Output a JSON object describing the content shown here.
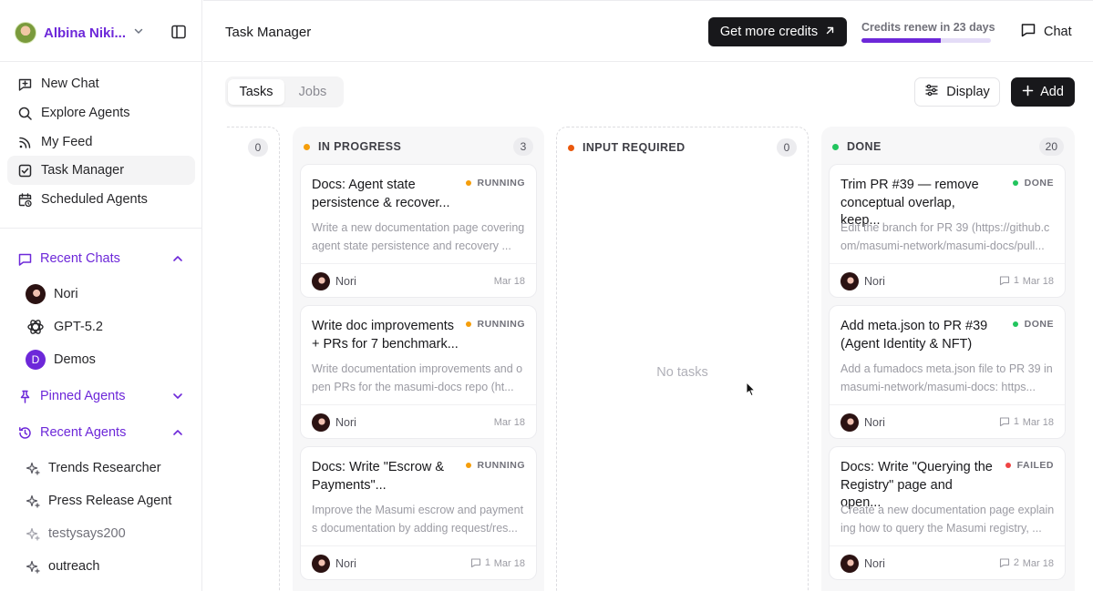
{
  "sidebar": {
    "user_name": "Albina Niki...",
    "nav": [
      {
        "label": "New Chat",
        "icon": "new-chat-icon"
      },
      {
        "label": "Explore Agents",
        "icon": "search-icon"
      },
      {
        "label": "My Feed",
        "icon": "rss-icon"
      },
      {
        "label": "Task Manager",
        "icon": "checkbox-icon",
        "active": true
      },
      {
        "label": "Scheduled Agents",
        "icon": "calendar-clock-icon"
      }
    ],
    "recent_chats": {
      "title": "Recent Chats",
      "items": [
        {
          "label": "Nori"
        },
        {
          "label": "GPT-5.2"
        },
        {
          "label": "Demos",
          "initial": "D"
        }
      ]
    },
    "pinned_agents": {
      "title": "Pinned Agents"
    },
    "recent_agents": {
      "title": "Recent Agents",
      "items": [
        {
          "label": "Trends Researcher"
        },
        {
          "label": "Press Release Agent"
        },
        {
          "label": "testysays200"
        },
        {
          "label": "outreach"
        }
      ]
    }
  },
  "header": {
    "title": "Task Manager",
    "credits_button": "Get more credits",
    "renew_text": "Credits renew in 23 days",
    "renew_progress": 0.61,
    "chat_button": "Chat"
  },
  "toolbar": {
    "tabs": [
      {
        "label": "Tasks",
        "active": true
      },
      {
        "label": "Jobs"
      }
    ],
    "display_button": "Display",
    "add_button": "Add"
  },
  "board": {
    "columns": [
      {
        "title": "",
        "count": "0"
      },
      {
        "title": "IN PROGRESS",
        "count": "3",
        "color": "#f59e0b",
        "cards": [
          {
            "title": "Docs: Agent state persistence & recover...",
            "status": "RUNNING",
            "desc": "Write a new documentation page covering agent state persistence and recovery ...",
            "assignee": "Nori",
            "comments": "",
            "date": "Mar 18"
          },
          {
            "title": "Write doc improvements + PRs for 7 benchmark...",
            "status": "RUNNING",
            "desc": "Write documentation improvements and open PRs for the masumi-docs repo (ht...",
            "assignee": "Nori",
            "comments": "",
            "date": "Mar 18"
          },
          {
            "title": "Docs: Write \"Escrow & Payments\"...",
            "status": "RUNNING",
            "desc": "Improve the Masumi escrow and payments documentation by adding request/res...",
            "assignee": "Nori",
            "comments": "1",
            "date": "Mar 18"
          }
        ]
      },
      {
        "title": "INPUT REQUIRED",
        "count": "0",
        "color": "#ea580c",
        "empty": "No tasks"
      },
      {
        "title": "DONE",
        "count": "20",
        "color": "#22c55e",
        "cards": [
          {
            "title": "Trim PR #39 — remove conceptual overlap, keep...",
            "status": "DONE",
            "desc": "Edit the branch for PR 39 (https://github.com/masumi-network/masumi-docs/pull...",
            "assignee": "Nori",
            "comments": "1",
            "date": "Mar 18"
          },
          {
            "title": "Add meta.json to PR #39 (Agent Identity & NFT)",
            "status": "DONE",
            "desc": "Add a fumadocs meta.json file to PR 39 in masumi-network/masumi-docs: https...",
            "assignee": "Nori",
            "comments": "1",
            "date": "Mar 18"
          },
          {
            "title": "Docs: Write \"Querying the Registry\" page and open...",
            "status": "FAILED",
            "desc": "Create a new documentation page explaining how to query the Masumi registry, ...",
            "assignee": "Nori",
            "comments": "2",
            "date": "Mar 18"
          }
        ]
      }
    ]
  },
  "colors": {
    "accent": "#6d28d9",
    "running": "#f59e0b",
    "input_required": "#ea580c",
    "done": "#22c55e",
    "failed": "#ef4444"
  }
}
